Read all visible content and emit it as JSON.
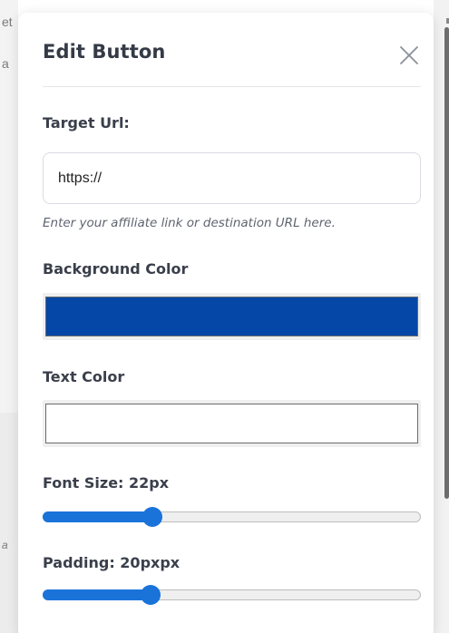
{
  "modal": {
    "title": "Edit Button",
    "target_url": {
      "label": "Target Url:",
      "value": "https://",
      "help": "Enter your affiliate link or destination URL here."
    },
    "background_color": {
      "label": "Background Color",
      "value": "#0447a6"
    },
    "text_color": {
      "label": "Text Color",
      "value": "#ffffff"
    },
    "font_size": {
      "label": "Font Size: 22px",
      "fraction": 0.29
    },
    "padding": {
      "label": "Padding: 20pxpx",
      "fraction": 0.285
    },
    "icons": {
      "close": "close-icon"
    }
  },
  "background": {
    "fragments": [
      "et",
      "a",
      "a"
    ]
  },
  "colors": {
    "accent": "#1a73d9",
    "title_text": "#343a46",
    "label_text": "#3a3f4b",
    "help_text": "#5f6470"
  }
}
